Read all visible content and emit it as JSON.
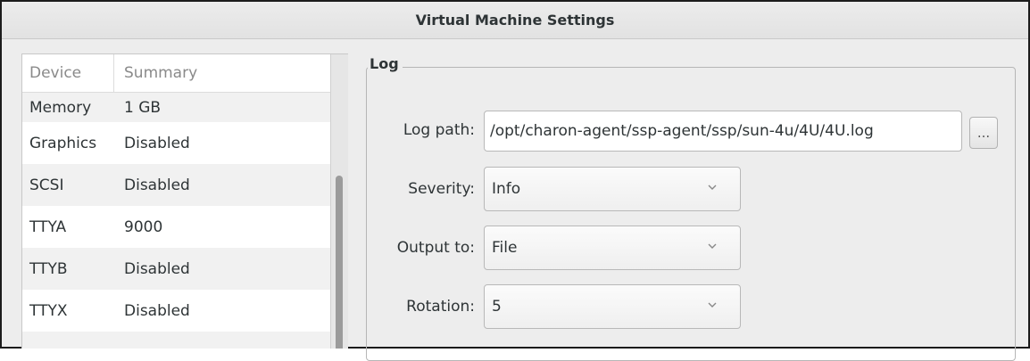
{
  "window": {
    "title": "Virtual Machine Settings"
  },
  "device_list": {
    "columns": [
      "Device",
      "Summary"
    ],
    "rows": [
      {
        "device": "Memory",
        "summary": "1 GB"
      },
      {
        "device": "Graphics",
        "summary": "Disabled"
      },
      {
        "device": "SCSI",
        "summary": "Disabled"
      },
      {
        "device": "TTYA",
        "summary": "9000"
      },
      {
        "device": "TTYB",
        "summary": "Disabled"
      },
      {
        "device": "TTYX",
        "summary": "Disabled"
      }
    ]
  },
  "log": {
    "section_title": "Log",
    "path_label": "Log path:",
    "path_value": "/opt/charon-agent/ssp-agent/ssp/sun-4u/4U/4U.log",
    "browse_label": "...",
    "severity_label": "Severity:",
    "severity_value": "Info",
    "output_label": "Output to:",
    "output_value": "File",
    "rotation_label": "Rotation:",
    "rotation_value": "5"
  },
  "icons": {
    "dropdown": "chevron-down-icon"
  }
}
